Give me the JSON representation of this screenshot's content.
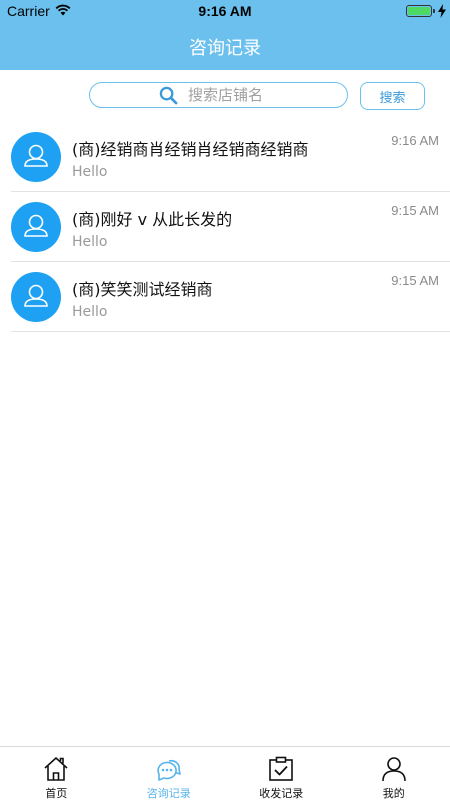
{
  "status_bar": {
    "carrier": "Carrier",
    "time": "9:16 AM"
  },
  "nav": {
    "title": "咨询记录"
  },
  "search": {
    "placeholder": "搜索店铺名",
    "button_label": "搜索"
  },
  "conversations": [
    {
      "name": "(商)经销商肖经销肖经销商经销商",
      "message": "Hello",
      "time": "9:16 AM"
    },
    {
      "name": "(商)刚好 v 从此长发的",
      "message": "Hello",
      "time": "9:15 AM"
    },
    {
      "name": "(商)笑笑测试经销商",
      "message": "Hello",
      "time": "9:15 AM"
    }
  ],
  "tabs": [
    {
      "label": "首页",
      "icon": "home-icon",
      "active": false
    },
    {
      "label": "咨询记录",
      "icon": "chat-icon",
      "active": true
    },
    {
      "label": "收发记录",
      "icon": "clipboard-check-icon",
      "active": false
    },
    {
      "label": "我的",
      "icon": "person-icon",
      "active": false
    }
  ],
  "colors": {
    "accent": "#6cc0ee",
    "avatar": "#1ea1f2",
    "active_tab": "#55b4ec"
  }
}
